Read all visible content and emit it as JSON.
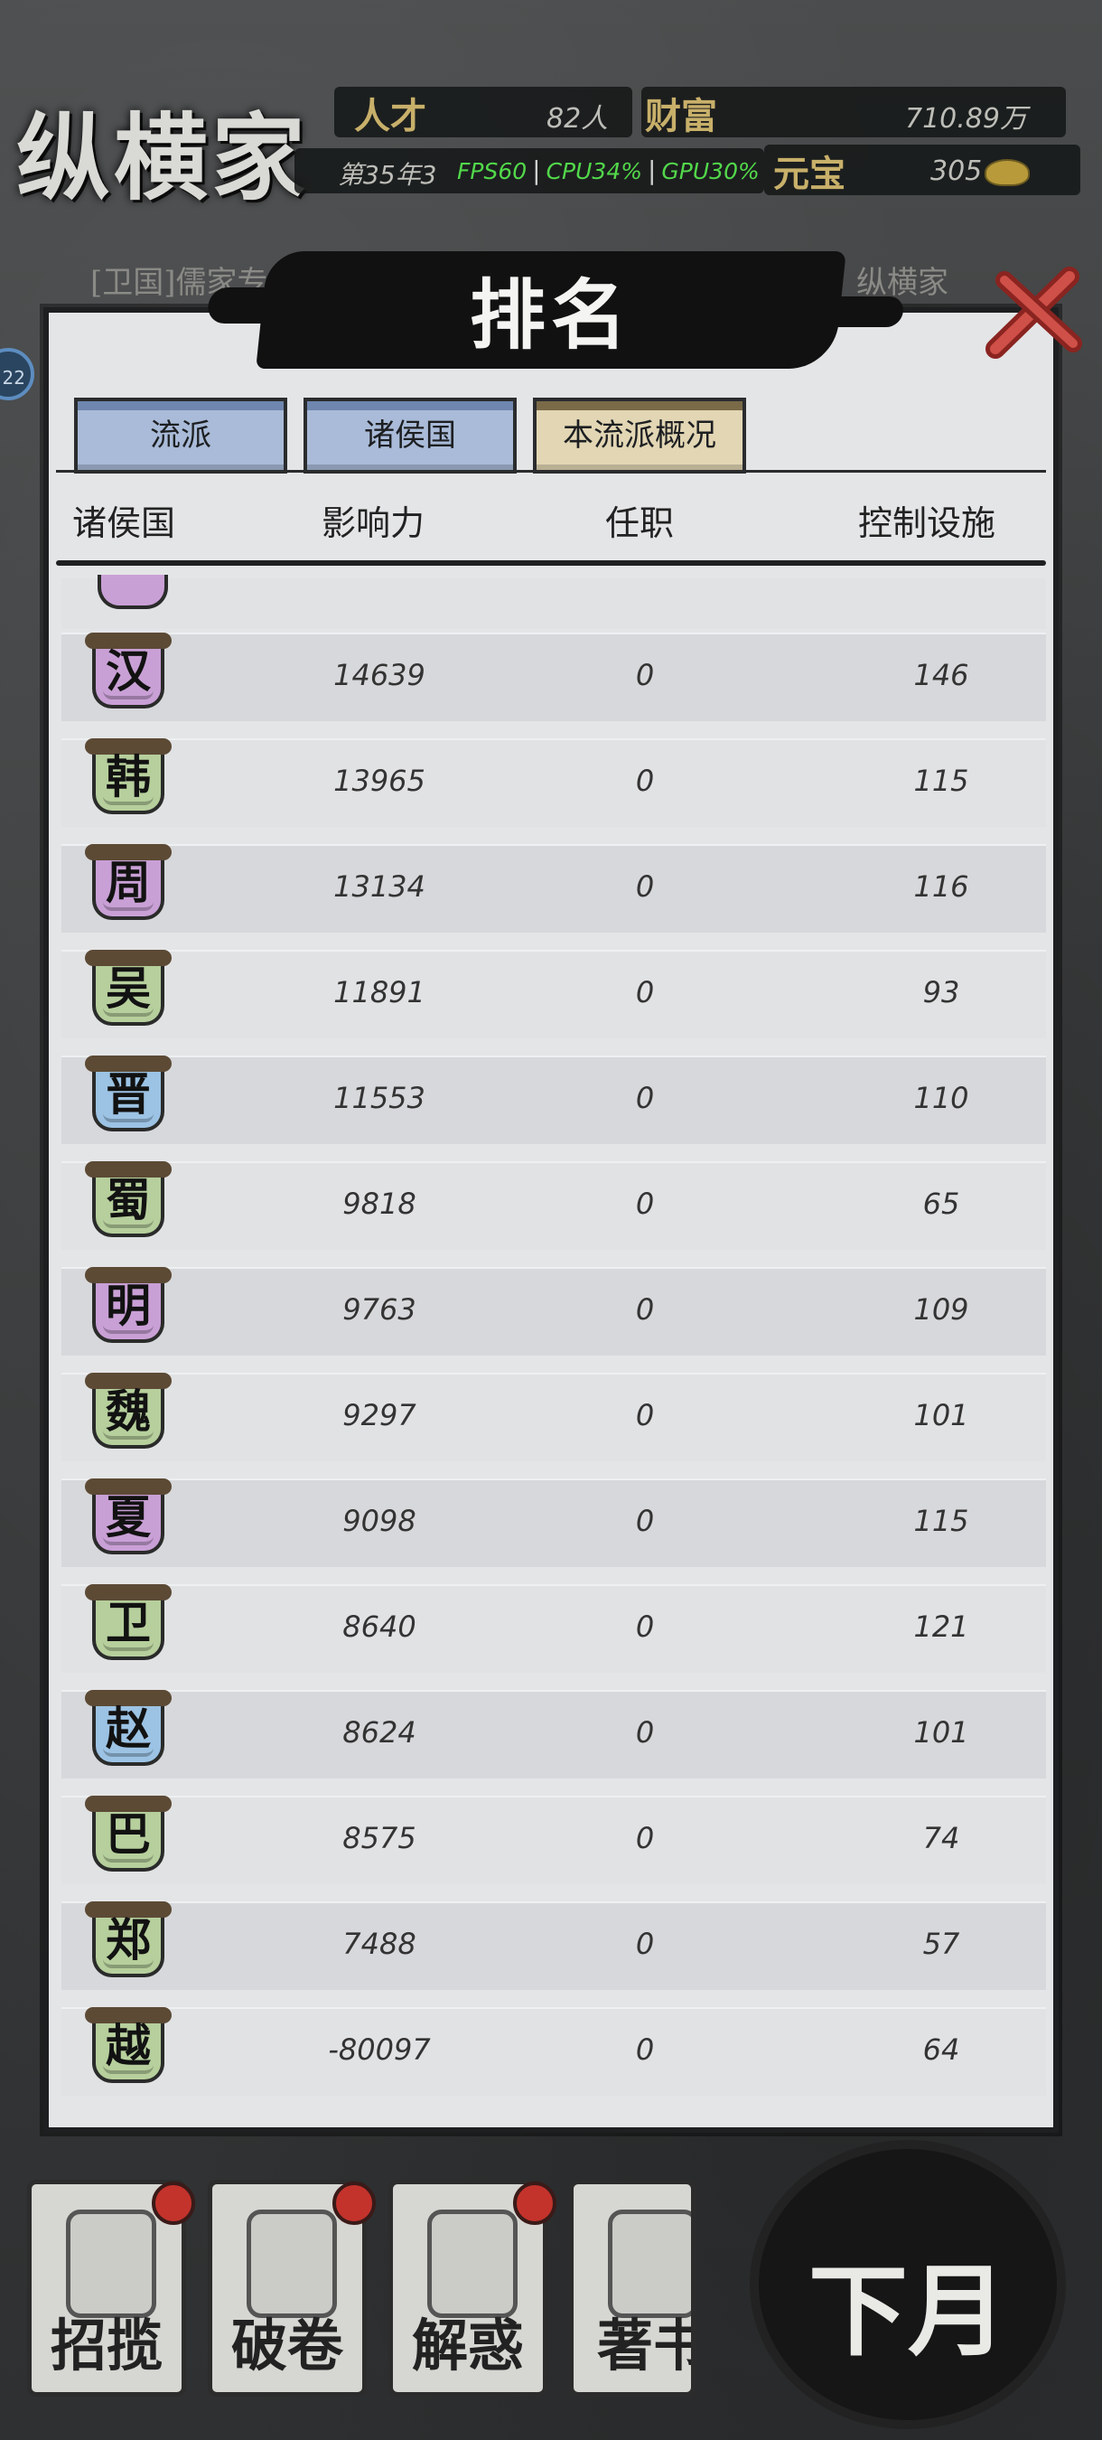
{
  "hud": {
    "school_name": "纵横家",
    "talent_label": "人才",
    "talent_value": "82人",
    "wealth_label": "财富",
    "wealth_value": "710.89万",
    "year_text": "第35年3",
    "fps": "FPS60",
    "cpu": "CPU34%",
    "gpu": "GPU30%",
    "treasure_label": "元宝",
    "treasure_value": "305",
    "side_badge": "22",
    "notice_left": "[卫国]儒家专",
    "notice_right": "力，纵横家"
  },
  "panel": {
    "title": "排名",
    "tabs": [
      {
        "label": "流派",
        "active": false
      },
      {
        "label": "诸侯国",
        "active": false
      },
      {
        "label": "本流派概况",
        "active": true
      }
    ],
    "columns": {
      "state": "诸侯国",
      "influence": "影响力",
      "position": "任职",
      "control": "控制设施"
    },
    "rows": [
      {
        "state": "汉",
        "influence": "14639",
        "position": "0",
        "control": "146",
        "color": "#c9a0d6"
      },
      {
        "state": "韩",
        "influence": "13965",
        "position": "0",
        "control": "115",
        "color": "#b6cf9c"
      },
      {
        "state": "周",
        "influence": "13134",
        "position": "0",
        "control": "116",
        "color": "#c9a0d6"
      },
      {
        "state": "吴",
        "influence": "11891",
        "position": "0",
        "control": "93",
        "color": "#b6cf9c"
      },
      {
        "state": "晋",
        "influence": "11553",
        "position": "0",
        "control": "110",
        "color": "#9cc3e4"
      },
      {
        "state": "蜀",
        "influence": "9818",
        "position": "0",
        "control": "65",
        "color": "#b6cf9c"
      },
      {
        "state": "明",
        "influence": "9763",
        "position": "0",
        "control": "109",
        "color": "#c9a0d6"
      },
      {
        "state": "魏",
        "influence": "9297",
        "position": "0",
        "control": "101",
        "color": "#b6cf9c"
      },
      {
        "state": "夏",
        "influence": "9098",
        "position": "0",
        "control": "115",
        "color": "#c9a0d6"
      },
      {
        "state": "卫",
        "influence": "8640",
        "position": "0",
        "control": "121",
        "color": "#b6cf9c"
      },
      {
        "state": "赵",
        "influence": "8624",
        "position": "0",
        "control": "101",
        "color": "#9cc3e4"
      },
      {
        "state": "巴",
        "influence": "8575",
        "position": "0",
        "control": "74",
        "color": "#b6cf9c"
      },
      {
        "state": "郑",
        "influence": "7488",
        "position": "0",
        "control": "57",
        "color": "#b6cf9c"
      },
      {
        "state": "越",
        "influence": "-80097",
        "position": "0",
        "control": "64",
        "color": "#b6cf9c"
      }
    ]
  },
  "bottom": {
    "buttons": [
      {
        "label": "招揽",
        "has_alert": true
      },
      {
        "label": "破卷",
        "has_alert": true
      },
      {
        "label": "解惑",
        "has_alert": true
      },
      {
        "label": "著书",
        "has_alert": false
      }
    ],
    "next_month": "下月"
  }
}
